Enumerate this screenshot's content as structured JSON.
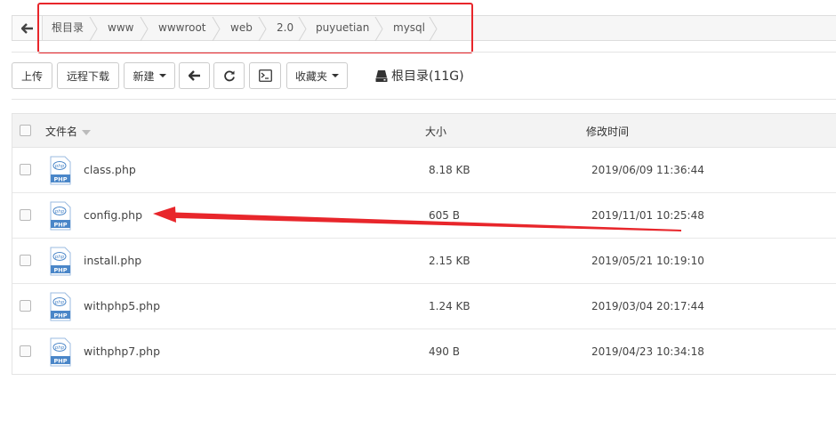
{
  "breadcrumb": {
    "items": [
      "根目录",
      "www",
      "wwwroot",
      "web",
      "2.0",
      "puyuetian",
      "mysql"
    ]
  },
  "toolbar": {
    "upload_label": "上传",
    "remote_download_label": "远程下载",
    "new_label": "新建",
    "favorites_label": "收藏夹",
    "disk_label": "根目录(11G)"
  },
  "table": {
    "headers": {
      "name": "文件名",
      "size": "大小",
      "modified": "修改时间"
    },
    "rows": [
      {
        "name": "class.php",
        "size": "8.18 KB",
        "modified": "2019/06/09 11:36:44",
        "icon": "php-file-icon"
      },
      {
        "name": "config.php",
        "size": "605 B",
        "modified": "2019/11/01 10:25:48",
        "icon": "php-file-icon"
      },
      {
        "name": "install.php",
        "size": "2.15 KB",
        "modified": "2019/05/21 10:19:10",
        "icon": "php-file-icon"
      },
      {
        "name": "withphp5.php",
        "size": "1.24 KB",
        "modified": "2019/03/04 20:17:44",
        "icon": "php-file-icon"
      },
      {
        "name": "withphp7.php",
        "size": "490 B",
        "modified": "2019/04/23 10:34:18",
        "icon": "php-file-icon"
      }
    ],
    "icon_text": "PHP"
  },
  "colors": {
    "annotation_red": "#e8262b",
    "icon_blue": "#4a86c8"
  }
}
